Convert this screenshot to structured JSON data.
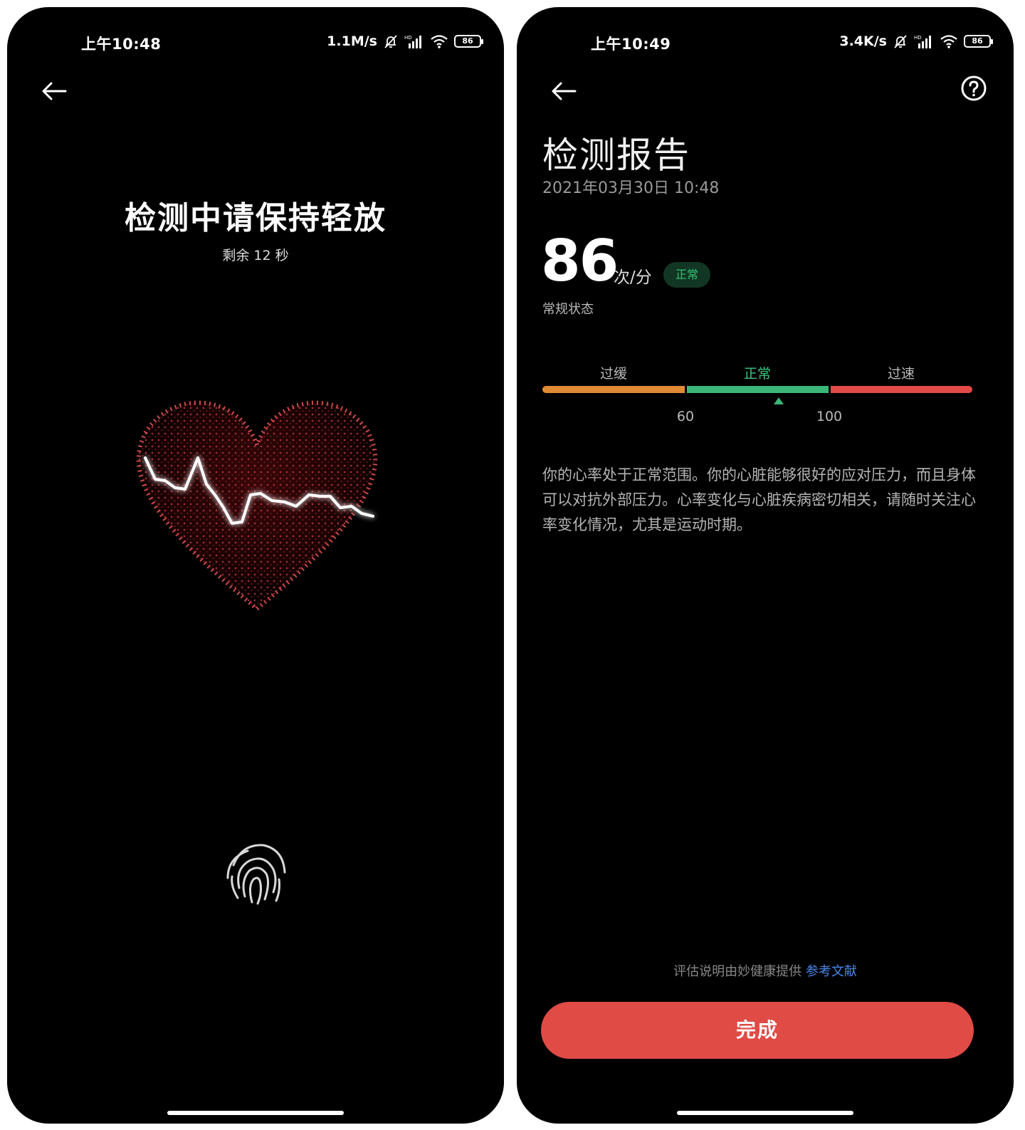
{
  "left_screen": {
    "status_bar": {
      "time": "上午10:48",
      "net_speed": "1.1M/s",
      "battery": "86"
    },
    "title": "检测中请保持轻放",
    "countdown": "剩余 12 秒"
  },
  "right_screen": {
    "status_bar": {
      "time": "上午10:49",
      "net_speed": "3.4K/s",
      "battery": "86"
    },
    "title": "检测报告",
    "date": "2021年03月30日 10:48",
    "heart_rate": {
      "value": "86",
      "unit": "次/分",
      "badge": "正常",
      "state": "常规状态"
    },
    "range": {
      "labels": [
        "过缓",
        "正常",
        "过速"
      ],
      "ticks": [
        "60",
        "100"
      ],
      "colors": {
        "slow": "#e08a36",
        "normal": "#3bb678",
        "fast": "#e24a47"
      }
    },
    "description": "你的心率处于正常范围。你的心脏能够很好的应对压力，而且身体可以对抗外部压力。心率变化与心脏疾病密切相关，请随时关注心率变化情况，尤其是运动时期。",
    "provider": {
      "text": "评估说明由妙健康提供",
      "link": "参考文献"
    },
    "done_button": "完成"
  }
}
